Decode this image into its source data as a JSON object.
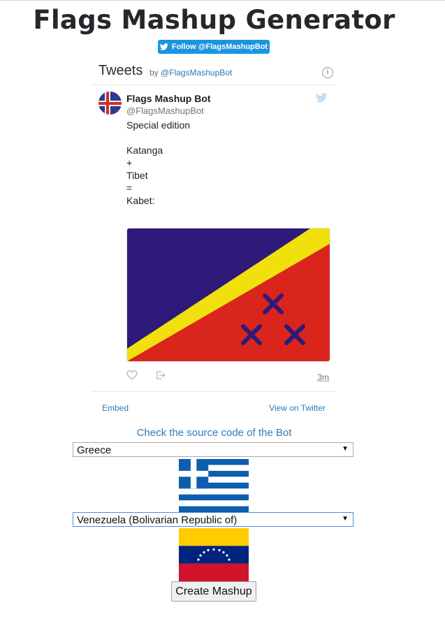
{
  "title": "Flags Mashup Generator",
  "follow_button": {
    "label": "Follow @FlagsMashupBot"
  },
  "timeline": {
    "title": "Tweets",
    "by_prefix": "by",
    "by_handle": "@FlagsMashupBot",
    "tweet": {
      "author": "Flags Mashup Bot",
      "handle": "@FlagsMashupBot",
      "lines": [
        "Special edition",
        "",
        "Katanga",
        "+",
        "Tibet",
        "=",
        "Kabet:"
      ],
      "timestamp": "3m"
    },
    "embed_label": "Embed",
    "view_label": "View on Twitter"
  },
  "source_link": "Check the source code of the Bot",
  "select1": {
    "value": "Greece"
  },
  "select2": {
    "value": "Venezuela (Bolivarian Republic of)"
  },
  "create_button": "Create Mashup",
  "colors": {
    "twitter_blue": "#1b95e0",
    "link_blue": "#337ab7",
    "mashup_purple": "#2e1a78",
    "mashup_yellow": "#f2e00e",
    "mashup_red": "#da251d",
    "greece_blue": "#0d5eaf",
    "venezuela_yellow": "#ffcc00",
    "venezuela_blue": "#00247d",
    "venezuela_red": "#cf142b"
  }
}
